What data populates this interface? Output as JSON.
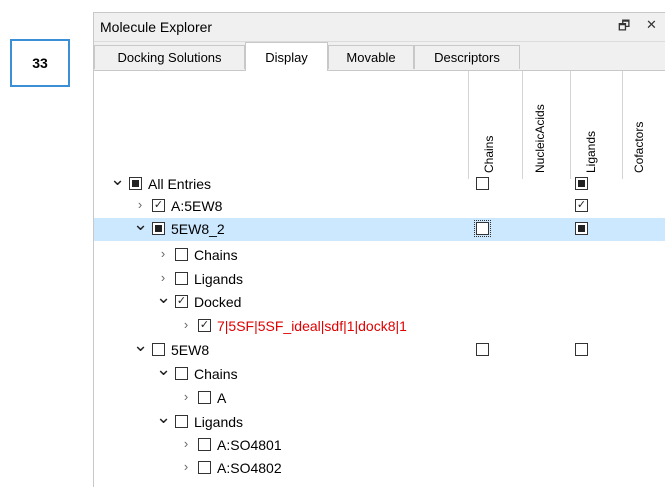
{
  "badge": {
    "number": "33"
  },
  "window": {
    "title": "Molecule Explorer",
    "float_glyph": "🗗",
    "close_glyph": "✕"
  },
  "tabs": [
    {
      "label": "Docking Solutions",
      "active": false
    },
    {
      "label": "Display",
      "active": true
    },
    {
      "label": "Movable",
      "active": false
    },
    {
      "label": "Descriptors",
      "active": false
    }
  ],
  "columns": [
    "Chains",
    "NucleicAcids",
    "Ligands",
    "Cofactors"
  ],
  "icons": {
    "expanded": "chevron-down-icon",
    "collapsed": "chevron-right-icon"
  },
  "tree": [
    {
      "label": "All Entries",
      "expanded": true,
      "state": "partial",
      "chains": "unchecked",
      "ligands": "partial",
      "selected": false
    },
    {
      "label": "A:5EW8",
      "expanded": false,
      "state": "checked",
      "chains": null,
      "ligands": "checked",
      "selected": false
    },
    {
      "label": "5EW8_2",
      "expanded": true,
      "state": "partial",
      "chains": "unchecked",
      "ligands": "partial",
      "selected": true
    },
    {
      "label": "Chains",
      "expanded": false,
      "state": "unchecked",
      "selected": false
    },
    {
      "label": "Ligands",
      "expanded": false,
      "state": "unchecked",
      "selected": false
    },
    {
      "label": "Docked",
      "expanded": true,
      "state": "checked",
      "selected": false
    },
    {
      "label": "7|5SF|5SF_ideal|sdf|1|dock8|1",
      "expanded": false,
      "state": "checked",
      "red": true,
      "selected": false
    },
    {
      "label": "5EW8",
      "expanded": true,
      "state": "unchecked",
      "chains": "unchecked",
      "ligands": "unchecked",
      "selected": false
    },
    {
      "label": "Chains",
      "expanded": true,
      "state": "unchecked",
      "selected": false
    },
    {
      "label": "A",
      "expanded": false,
      "state": "unchecked",
      "selected": false
    },
    {
      "label": "Ligands",
      "expanded": true,
      "state": "unchecked",
      "selected": false
    },
    {
      "label": "A:SO4801",
      "expanded": false,
      "state": "unchecked",
      "selected": false
    },
    {
      "label": "A:SO4802",
      "expanded": false,
      "state": "unchecked",
      "selected": false
    }
  ]
}
